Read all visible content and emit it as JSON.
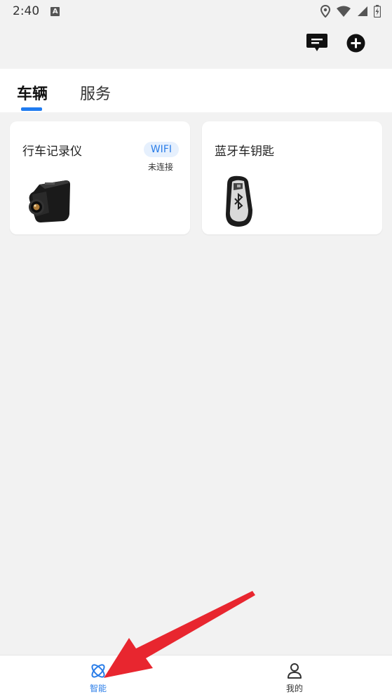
{
  "status_bar": {
    "time": "2:40",
    "icons": [
      "notification-a-icon",
      "location-icon",
      "wifi-icon",
      "signal-icon",
      "battery-icon"
    ]
  },
  "header": {
    "icons": [
      "message-icon",
      "add-circle-icon"
    ]
  },
  "tabs": [
    {
      "label": "车辆",
      "active": true
    },
    {
      "label": "服务",
      "active": false
    }
  ],
  "cards": [
    {
      "title": "行车记录仪",
      "badge": "WIFI",
      "status": "未连接",
      "image_icon": "dashcam-icon"
    },
    {
      "title": "蓝牙车钥匙",
      "image_icon": "car-key-icon"
    }
  ],
  "bottom_nav": [
    {
      "label": "智能",
      "icon": "smart-icon",
      "active": true
    },
    {
      "label": "我的",
      "icon": "user-icon",
      "active": false
    }
  ],
  "colors": {
    "accent": "#1f7bf0",
    "annotation_arrow": "#e8262f",
    "background": "#f2f2f2"
  }
}
